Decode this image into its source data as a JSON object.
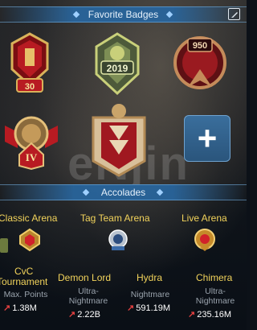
{
  "favorites": {
    "title": "Favorite Badges",
    "badges": [
      {
        "name": "badge-30",
        "text": "30"
      },
      {
        "name": "badge-2019",
        "text": "2019"
      },
      {
        "name": "badge-950",
        "text": "950"
      },
      {
        "name": "badge-iv",
        "text": "IV"
      },
      {
        "name": "badge-dragon-banner",
        "text": ""
      }
    ],
    "add_symbol": "+"
  },
  "watermark": "eNjin",
  "accolades": {
    "title": "Accolades",
    "arenas": [
      {
        "label": "Classic Arena"
      },
      {
        "label": "Tag Team Arena"
      },
      {
        "label": "Live Arena"
      }
    ],
    "stats": [
      {
        "title_line1": "CvC",
        "title_line2": "Tournament",
        "sub": "Max. Points",
        "value": "1.38M"
      },
      {
        "title_line1": "Demon Lord",
        "sub_line1": "Ultra-",
        "sub_line2": "Nightmare",
        "value": "2.22B"
      },
      {
        "title_line1": "Hydra",
        "sub_line1": "Nightmare",
        "value": "591.19M"
      },
      {
        "title_line1": "Chimera",
        "sub_line1": "Ultra-",
        "sub_line2": "Nightmare",
        "value": "235.16M"
      }
    ]
  },
  "colors": {
    "header": "#28649b",
    "gold_text": "#f2d35b",
    "add_button": "#2f5f8a",
    "arrow": "#e34040"
  }
}
